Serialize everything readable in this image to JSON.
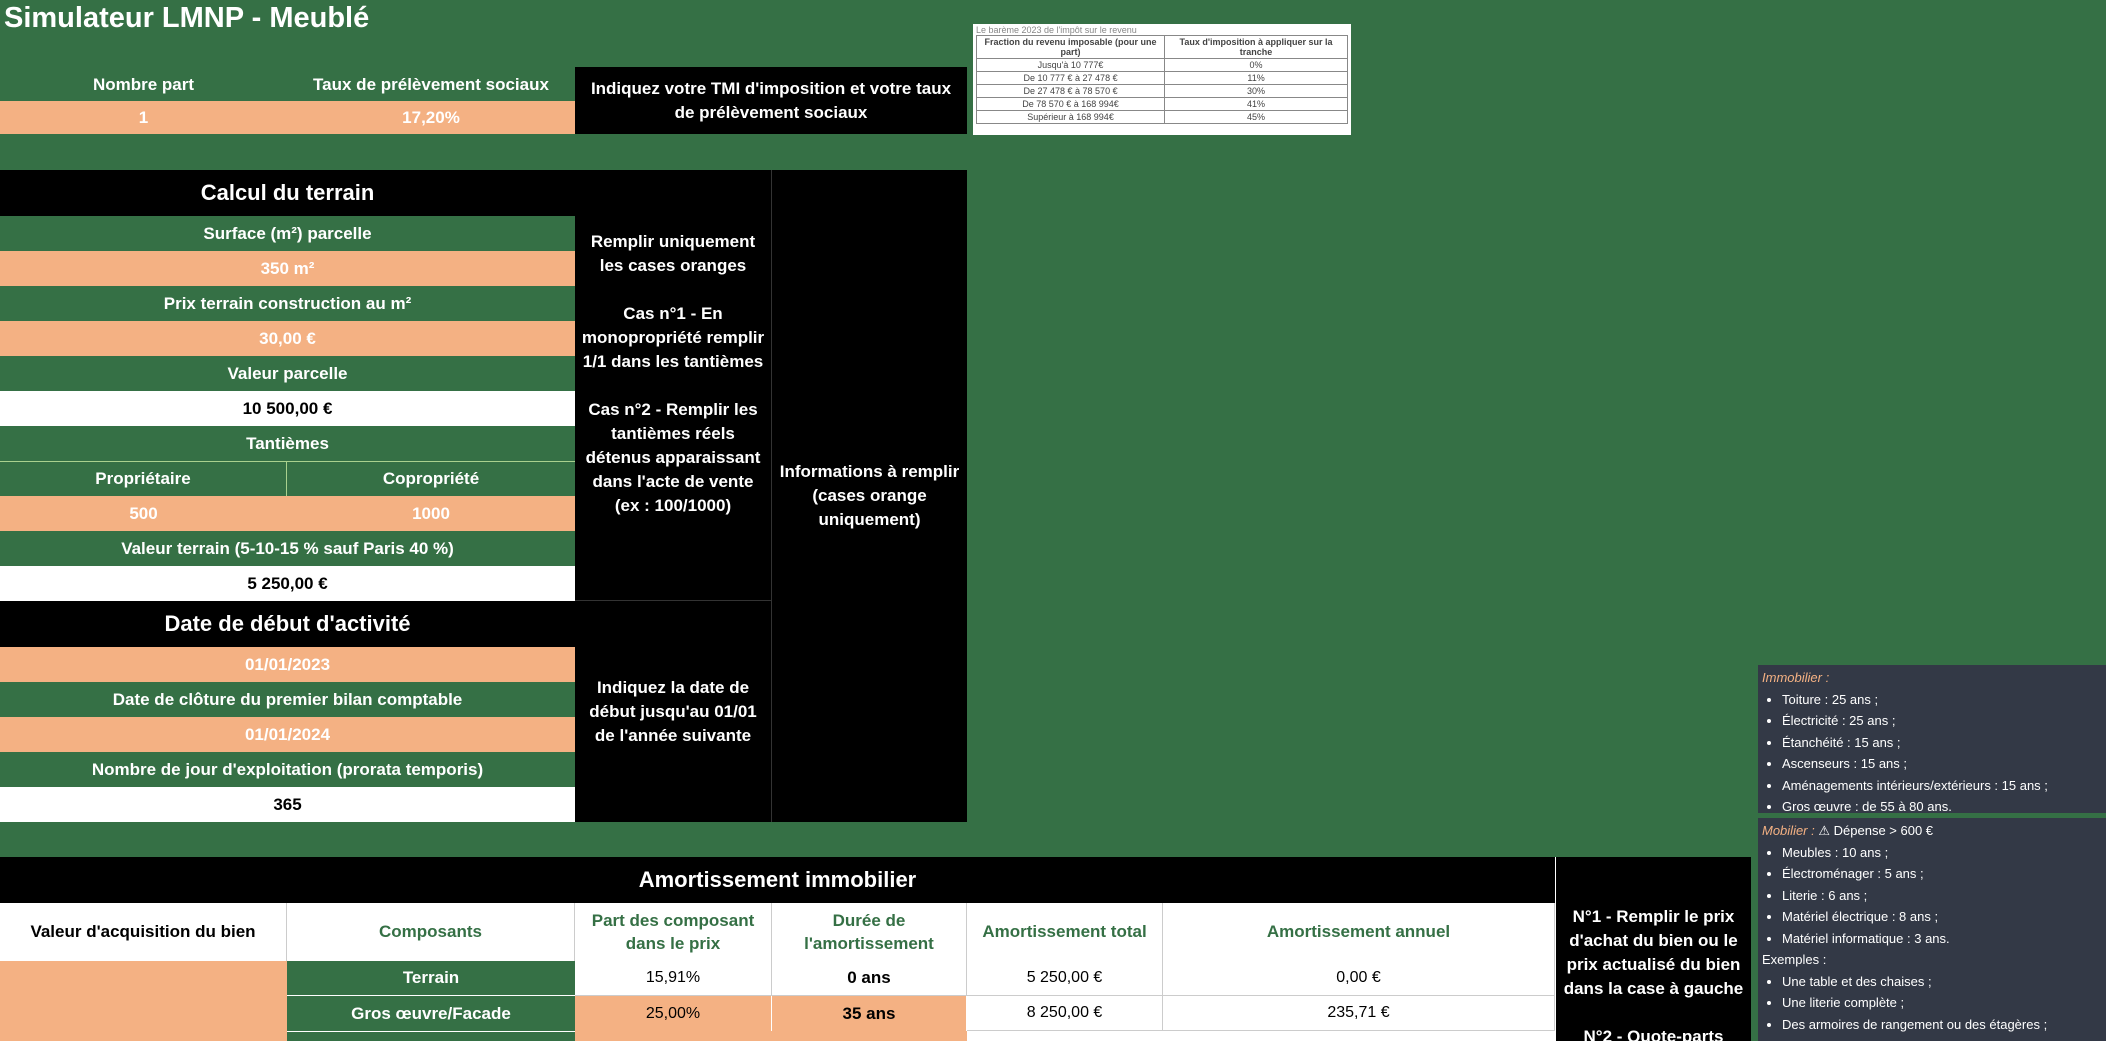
{
  "app_title": "Simulateur LMNP - Meublé",
  "social": {
    "nb_part_label": "Nombre part",
    "nb_part_value": "1",
    "taux_label": "Taux de prélèvement sociaux",
    "taux_value": "17,20%",
    "info": "Indiquez votre TMI d'imposition et votre taux de prélèvement sociaux"
  },
  "bareme": {
    "caption": "Le barème 2023 de l'impôt sur le revenu",
    "headers": [
      "Fraction du revenu imposable (pour une part)",
      "Taux d'imposition à appliquer sur la tranche"
    ],
    "rows": [
      [
        "Jusqu'à 10 777€",
        "0%"
      ],
      [
        "De 10 777 € à 27 478 €",
        "11%"
      ],
      [
        "De 27 478 € à 78 570 €",
        "30%"
      ],
      [
        "De 78 570 € à 168 994€",
        "41%"
      ],
      [
        "Supérieur à 168 994€",
        "45%"
      ]
    ]
  },
  "terrain": {
    "title": "Calcul du terrain",
    "surface_label": "Surface (m²) parcelle",
    "surface_value": "350 m²",
    "prix_label": "Prix terrain construction au m²",
    "prix_value": "30,00 €",
    "valeur_parcelle_label": "Valeur parcelle",
    "valeur_parcelle_value": "10 500,00 €",
    "tantiemes_label": "Tantièmes",
    "proprietaire_label": "Propriétaire",
    "copropriete_label": "Copropriété",
    "proprietaire_value": "500",
    "copropriete_value": "1000",
    "valeur_terrain_label": "Valeur terrain  (5-10-15 % sauf Paris 40 %)",
    "valeur_terrain_value": "5 250,00 €"
  },
  "activite": {
    "title": "Date de début d'activité",
    "date_debut": "01/01/2023",
    "cloture_label": "Date de clôture du premier bilan comptable",
    "date_cloture": "01/01/2024",
    "jours_label": "Nombre de jour d'exploitation (prorata temporis)",
    "jours_value": "365"
  },
  "instructions": {
    "terrain_p1": "Remplir uniquement les cases oranges",
    "terrain_p2": "Cas n°1 - En monopropriété remplir 1/1 dans les tantièmes",
    "terrain_p3": "Cas n°2 - Remplir les tantièmes réels détenus apparaissant dans l'acte de vente (ex : 100/1000)",
    "date": "Indiquez la date de début jusqu'au 01/01 de l'année suivante",
    "informations": "Informations à remplir (cases orange uniquement)",
    "amort_p1": "N°1 - Remplir le prix d'achat du bien ou le prix actualisé du bien dans la case à gauche",
    "amort_p2": "N°2 - Quote-parts"
  },
  "amortissement": {
    "title": "Amortissement immobilier",
    "headers": {
      "valeur": "Valeur d'acquisition du bien",
      "composants": "Composants",
      "part": "Part des composant dans le prix",
      "duree": "Durée de l'amortissement",
      "total": "Amortissement total",
      "annuel": "Amortissement annuel"
    },
    "rows": [
      {
        "composant": "Terrain",
        "part": "15,91%",
        "duree": "0 ans",
        "total": "5 250,00 €",
        "annuel": "0,00 €"
      },
      {
        "composant": "Gros œuvre/Facade",
        "part": "25,00%",
        "duree": "35 ans",
        "total": "8 250,00 €",
        "annuel": "235,71 €"
      }
    ]
  },
  "notes_immobilier": {
    "heading": "Immobilier :",
    "items": [
      "Toiture : 25 ans ;",
      "Électricité : 25 ans ;",
      "Étanchéité : 15 ans ;",
      "Ascenseurs : 15 ans ;",
      "Aménagements intérieurs/extérieurs : 15 ans ;",
      "Gros œuvre : de 55 à 80 ans."
    ]
  },
  "notes_mobilier": {
    "heading": "Mobilier :",
    "warning": "Dépense > 600 €",
    "items": [
      "Meubles : 10 ans ;",
      "Électroménager : 5 ans ;",
      "Literie : 6 ans ;",
      "Matériel électrique : 8 ans ;",
      "Matériel informatique : 3 ans."
    ],
    "examples_label": "Exemples :",
    "examples": [
      "Une table et des chaises ;",
      "Une literie complète ;",
      "Des armoires de rangement ou des étagères ;"
    ]
  }
}
